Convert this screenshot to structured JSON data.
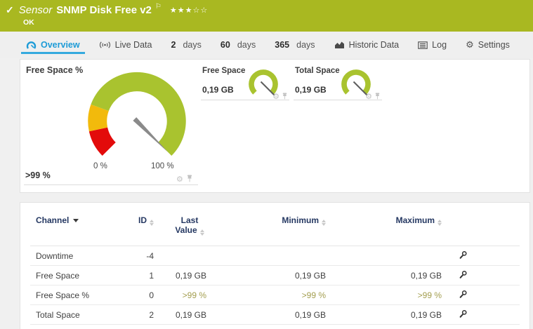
{
  "icons": {
    "check": "✓",
    "flag": "⚐",
    "gear": "⚙"
  },
  "colors": {
    "header_bg": "#a9b821",
    "gauge_green": "#a9c32f",
    "gauge_yellow": "#f2ba0c",
    "gauge_red": "#e30b0b",
    "tab_active_blue": "#1d9bd7",
    "table_header_text": "#253862",
    "limit_value_text": "#a39e4f"
  },
  "header": {
    "sensor_label": "Sensor",
    "title": "SNMP Disk Free v2",
    "status": "OK",
    "stars_filled": "★★★",
    "stars_empty": "☆☆",
    "rating": "3 of 5"
  },
  "tabs": [
    {
      "label": "Overview",
      "active": true
    },
    {
      "label": "Live Data"
    },
    {
      "number": "2",
      "unit": "days"
    },
    {
      "number": "60",
      "unit": "days"
    },
    {
      "number": "365",
      "unit": "days"
    },
    {
      "label": "Historic Data"
    },
    {
      "label": "Log"
    },
    {
      "label": "Settings"
    }
  ],
  "overview": {
    "main_gauge": {
      "title": "Free Space %",
      "value": ">99 %",
      "scale_min": "0 %",
      "scale_max": "100 %",
      "needle_percent": 100
    },
    "mini_gauges": [
      {
        "title": "Free Space",
        "value": "0,19 GB",
        "needle_percent": 100
      },
      {
        "title": "Total Space",
        "value": "0,19 GB",
        "needle_percent": 100
      }
    ]
  },
  "table": {
    "columns": {
      "channel": "Channel",
      "id": "ID",
      "last": "Last Value",
      "min": "Minimum",
      "max": "Maximum"
    },
    "rows": [
      {
        "channel": "Downtime",
        "id": "-4",
        "last": "",
        "min": "",
        "max": ""
      },
      {
        "channel": "Free Space",
        "id": "1",
        "last": "0,19 GB",
        "min": "0,19 GB",
        "max": "0,19 GB"
      },
      {
        "channel": "Free Space %",
        "id": "0",
        "last": ">99 %",
        "min": ">99 %",
        "max": ">99 %"
      },
      {
        "channel": "Total Space",
        "id": "2",
        "last": "0,19 GB",
        "min": "0,19 GB",
        "max": "0,19 GB"
      }
    ]
  }
}
